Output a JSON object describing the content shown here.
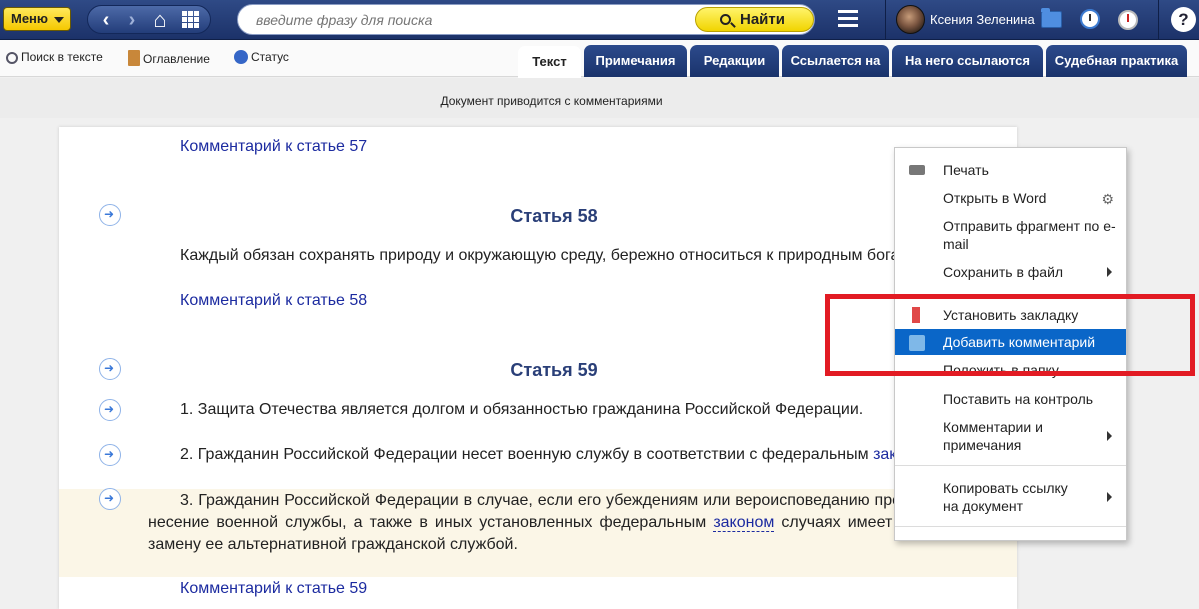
{
  "topbar": {
    "menu_label": "Меню",
    "search_placeholder": "введите фразу для поиска",
    "find_label": "Найти",
    "user_name": "Ксения Зеленина",
    "help_label": "?"
  },
  "toolbar": {
    "items": [
      "Поиск в тексте",
      "Оглавление",
      "Статус"
    ]
  },
  "tabs": {
    "items": [
      "Текст",
      "Примечания",
      "Редакции",
      "Ссылается на",
      "На него ссылаются",
      "Судебная практика"
    ]
  },
  "notice": "Документ приводится с комментариями",
  "document": {
    "comment57": "Комментарий к статье 57",
    "article58_title": "Статья 58",
    "article58_text": "Каждый обязан сохранять природу и окружающую среду, бережно относиться к природным богатст",
    "comment58": "Комментарий к статье 58",
    "article59_title": "Статья 59",
    "p1": "1. Защита Отечества является долгом и обязанностью гражданина Российской Федерации.",
    "p2_text": "2. Гражданин Российской Федерации несет военную службу в соответствии с федеральным ",
    "p2_link": "закон",
    "p3_before": "3. Гражданин Российской Федерации в случае, если его убеждениям или вероисповеданию прот несение военной службы, а также в иных установленных федеральным ",
    "p3_link": "законом",
    "p3_after": " случаях имеет п замену ее альтернативной гражданской службой.",
    "comment59": "Комментарий к статье 59"
  },
  "context_menu": {
    "print": "Печать",
    "open_word": "Открыть в Word",
    "send_email": "Отправить фрагмент по e-mail",
    "save_file": "Сохранить в файл",
    "bookmark": "Установить закладку",
    "add_comment": "Добавить комментарий",
    "to_folder": "Положить в папку",
    "to_control": "Поставить на контроль",
    "comments_notes": "Комментарии и примечания",
    "copy_link": "Копировать ссылку на документ"
  }
}
